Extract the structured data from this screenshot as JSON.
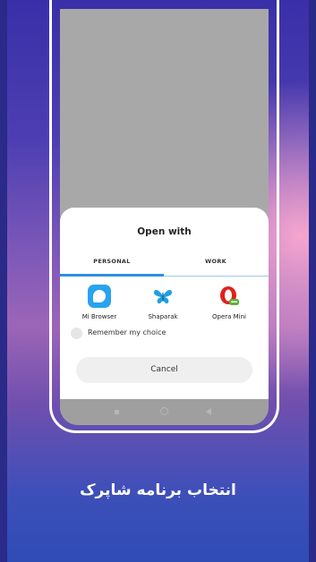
{
  "dialog": {
    "title": "Open with",
    "tabs": [
      {
        "label": "PERSONAL",
        "selected": true
      },
      {
        "label": "WORK",
        "selected": false
      }
    ],
    "apps": [
      {
        "label": "Mi Browser",
        "icon": "mi-browser-icon"
      },
      {
        "label": "Shaparak",
        "icon": "butterfly-icon"
      },
      {
        "label": "Opera Mini",
        "icon": "opera-mini-icon"
      }
    ],
    "remember_label": "Remember my choice",
    "cancel_label": "Cancel"
  },
  "navbar": {
    "items": [
      "recents-square-icon",
      "home-circle-icon",
      "back-triangle-icon"
    ]
  },
  "caption": "انتخاب برنامه شاپرک",
  "colors": {
    "accent": "#2d8fe3",
    "mi_browser": "#29a3f0",
    "shaparak": "#1e9fe0",
    "opera_red": "#e0201b",
    "opera_green": "#5bb13a"
  }
}
